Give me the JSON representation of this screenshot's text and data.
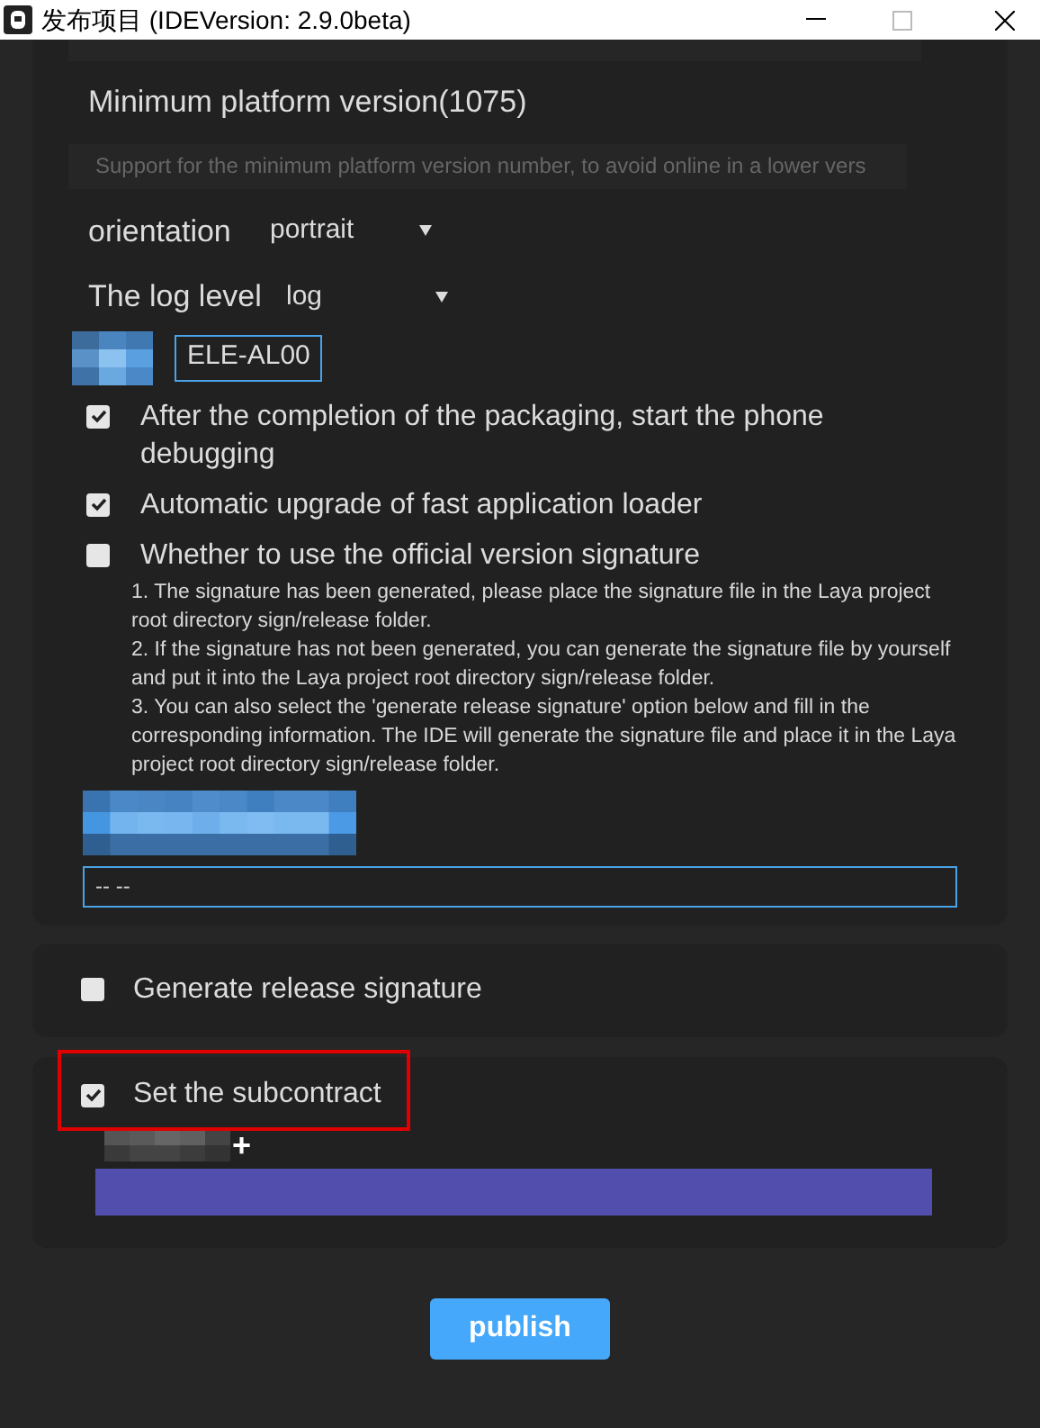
{
  "window": {
    "title": "发布项目 (IDEVersion: 2.9.0beta)"
  },
  "main_card": {
    "min_platform": {
      "label": "Minimum platform version(1075)",
      "placeholder": "Support for the minimum platform version number, to avoid online in a lower vers"
    },
    "selects": [
      {
        "label": "orientation",
        "value": "portrait"
      },
      {
        "label": "The log level",
        "value": "log"
      }
    ],
    "device_field": {
      "value": "ELE-AL00"
    },
    "options": [
      {
        "label": "After the completion of the packaging, start the phone debugging",
        "checked": true
      },
      {
        "label": "Automatic upgrade of fast application loader",
        "checked": true
      },
      {
        "label": "Whether to use the official version signature",
        "checked": false
      }
    ],
    "notes": [
      "1. The signature has been generated, please place the signature file in the Laya project root directory sign/release folder.",
      "2. If the signature has not been generated, you can generate the signature file by yourself and put it into the Laya project root directory sign/release folder.",
      "3. You can also select the 'generate release signature' option below and fill in the corresponding information. The IDE will generate the signature file and place it in the Laya project root directory sign/release folder."
    ],
    "signature_field": {
      "value": "-- --"
    }
  },
  "release_signature": {
    "label": "Generate release signature",
    "checked": false
  },
  "subcontract": {
    "label": "Set the subcontract",
    "checked": true,
    "add": "+"
  },
  "publish_button": "publish"
}
